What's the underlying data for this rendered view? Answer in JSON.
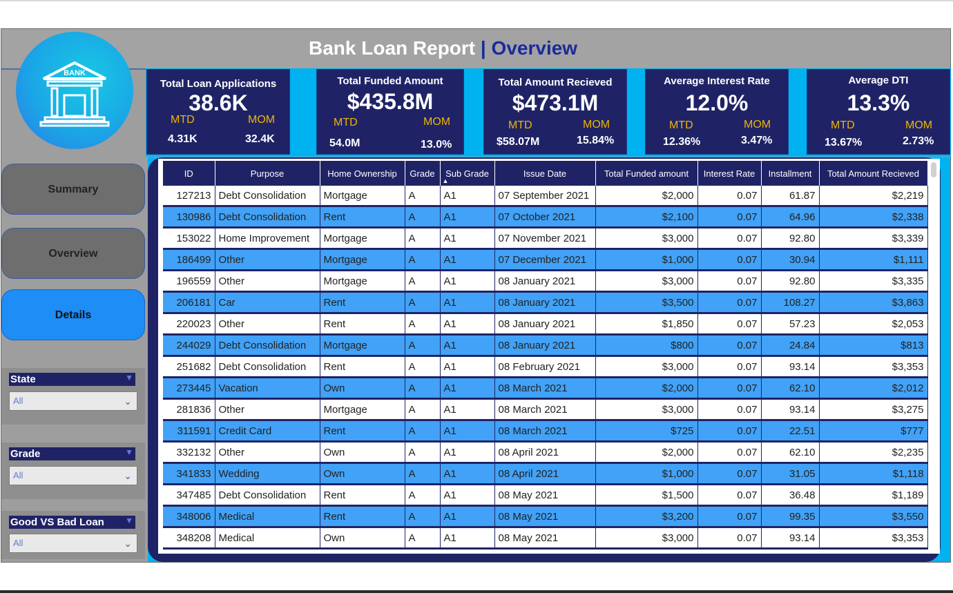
{
  "header": {
    "title_main": "Bank Loan Report",
    "title_sep": "|",
    "title_page": "Overview"
  },
  "logo": {
    "label": "BANK"
  },
  "kpis": [
    {
      "title": "Total Loan  Applications",
      "value": "38.6K",
      "mtd_label": "MTD",
      "mom_label": "MOM",
      "mtd": "4.31K",
      "mom": "32.4K"
    },
    {
      "title": "Total Funded Amount",
      "value": "$435.8M",
      "mtd_label": "MTD",
      "mom_label": "MOM",
      "mtd": "54.0M",
      "mom": "13.0%"
    },
    {
      "title": "Total Amount Recieved",
      "value": "$473.1M",
      "mtd_label": "MTD",
      "mom_label": "MOM",
      "mtd": "$58.07M",
      "mom": "15.84%"
    },
    {
      "title": "Average Interest Rate",
      "value": "12.0%",
      "mtd_label": "MTD",
      "mom_label": "MOM",
      "mtd": "12.36%",
      "mom": "3.47%"
    },
    {
      "title": "Average DTI",
      "value": "13.3%",
      "mtd_label": "MTD",
      "mom_label": "MOM",
      "mtd": "13.67%",
      "mom": "2.73%"
    }
  ],
  "nav": [
    {
      "label": "Summary",
      "active": false
    },
    {
      "label": "Overview",
      "active": false
    },
    {
      "label": "Details",
      "active": true
    }
  ],
  "slicers": [
    {
      "title": "State",
      "value": "All"
    },
    {
      "title": "Grade",
      "value": "All"
    },
    {
      "title": "Good VS Bad Loan",
      "value": "All"
    }
  ],
  "table": {
    "columns": [
      "ID",
      "Purpose",
      "Home Ownership",
      "Grade",
      "Sub Grade",
      "Issue Date",
      "Total Funded amount",
      "Interest Rate",
      "Installment",
      "Total Amount Recieved"
    ],
    "rows": [
      [
        "127213",
        "Debt Consolidation",
        "Mortgage",
        "A",
        "A1",
        "07 September 2021",
        "$2,000",
        "0.07",
        "61.87",
        "$2,219"
      ],
      [
        "130986",
        "Debt Consolidation",
        "Rent",
        "A",
        "A1",
        "07 October 2021",
        "$2,100",
        "0.07",
        "64.96",
        "$2,338"
      ],
      [
        "153022",
        "Home Improvement",
        "Mortgage",
        "A",
        "A1",
        "07 November 2021",
        "$3,000",
        "0.07",
        "92.80",
        "$3,339"
      ],
      [
        "186499",
        "Other",
        "Mortgage",
        "A",
        "A1",
        "07 December 2021",
        "$1,000",
        "0.07",
        "30.94",
        "$1,111"
      ],
      [
        "196559",
        "Other",
        "Mortgage",
        "A",
        "A1",
        "08 January 2021",
        "$3,000",
        "0.07",
        "92.80",
        "$3,335"
      ],
      [
        "206181",
        "Car",
        "Rent",
        "A",
        "A1",
        "08 January 2021",
        "$3,500",
        "0.07",
        "108.27",
        "$3,863"
      ],
      [
        "220023",
        "Other",
        "Rent",
        "A",
        "A1",
        "08 January 2021",
        "$1,850",
        "0.07",
        "57.23",
        "$2,053"
      ],
      [
        "244029",
        "Debt Consolidation",
        "Mortgage",
        "A",
        "A1",
        "08 January 2021",
        "$800",
        "0.07",
        "24.84",
        "$813"
      ],
      [
        "251682",
        "Debt Consolidation",
        "Rent",
        "A",
        "A1",
        "08 February 2021",
        "$3,000",
        "0.07",
        "93.14",
        "$3,353"
      ],
      [
        "273445",
        "Vacation",
        "Own",
        "A",
        "A1",
        "08 March 2021",
        "$2,000",
        "0.07",
        "62.10",
        "$2,012"
      ],
      [
        "281836",
        "Other",
        "Mortgage",
        "A",
        "A1",
        "08 March 2021",
        "$3,000",
        "0.07",
        "93.14",
        "$3,275"
      ],
      [
        "311591",
        "Credit Card",
        "Rent",
        "A",
        "A1",
        "08 March 2021",
        "$725",
        "0.07",
        "22.51",
        "$777"
      ],
      [
        "332132",
        "Other",
        "Own",
        "A",
        "A1",
        "08 April 2021",
        "$2,000",
        "0.07",
        "62.10",
        "$2,235"
      ],
      [
        "341833",
        "Wedding",
        "Own",
        "A",
        "A1",
        "08 April 2021",
        "$1,000",
        "0.07",
        "31.05",
        "$1,118"
      ],
      [
        "347485",
        "Debt Consolidation",
        "Rent",
        "A",
        "A1",
        "08 May 2021",
        "$1,500",
        "0.07",
        "36.48",
        "$1,189"
      ],
      [
        "348006",
        "Medical",
        "Rent",
        "A",
        "A1",
        "08 May 2021",
        "$3,200",
        "0.07",
        "99.35",
        "$3,550"
      ],
      [
        "348208",
        "Medical",
        "Own",
        "A",
        "A1",
        "08 May 2021",
        "$3,000",
        "0.07",
        "93.14",
        "$3,353"
      ]
    ]
  },
  "colors": {
    "navy": "#1f2366",
    "cyan": "#00b2f0",
    "row_blue": "#41a2f7",
    "gold": "#f1b500",
    "active_nav": "#1e8df5"
  }
}
